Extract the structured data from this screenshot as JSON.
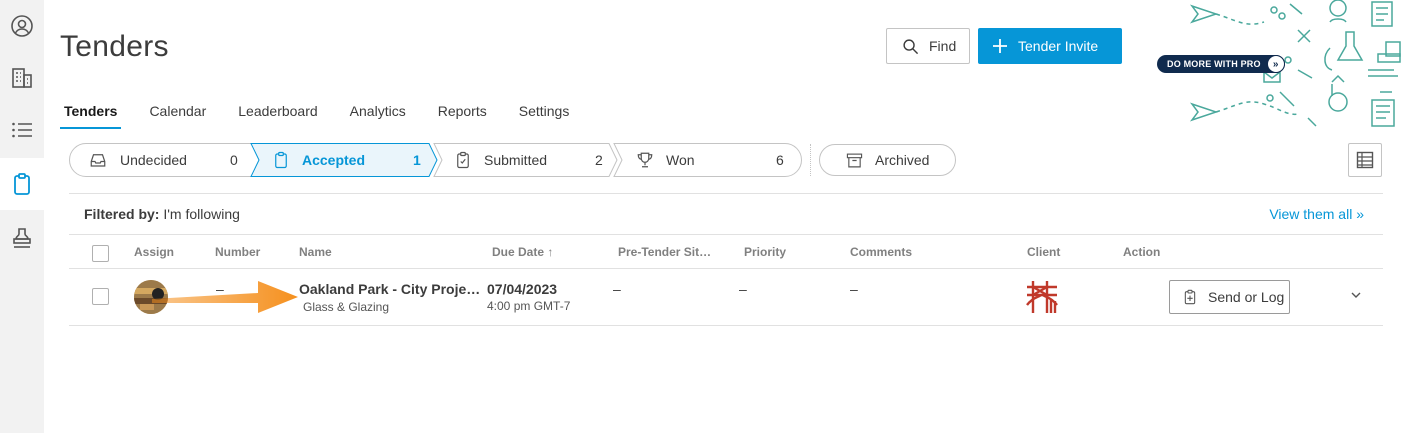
{
  "sidebar": {
    "items": [
      {
        "icon": "user-circle-icon"
      },
      {
        "icon": "building-icon"
      },
      {
        "icon": "list-icon"
      },
      {
        "icon": "clipboard-icon",
        "active": true
      },
      {
        "icon": "stamp-icon"
      }
    ]
  },
  "header": {
    "title": "Tenders",
    "find_label": "Find",
    "invite_label": "Tender Invite",
    "promo_label": "DO MORE WITH PRO"
  },
  "nav": {
    "tabs": [
      {
        "label": "Tenders",
        "active": true
      },
      {
        "label": "Calendar"
      },
      {
        "label": "Leaderboard"
      },
      {
        "label": "Analytics"
      },
      {
        "label": "Reports"
      },
      {
        "label": "Settings"
      }
    ]
  },
  "stages": [
    {
      "label": "Undecided",
      "count": "0",
      "icon": "inbox-tray-icon"
    },
    {
      "label": "Accepted",
      "count": "1",
      "icon": "clipboard-icon",
      "active": true
    },
    {
      "label": "Submitted",
      "count": "2",
      "icon": "clipboard-check-icon"
    },
    {
      "label": "Won",
      "count": "6",
      "icon": "trophy-icon"
    }
  ],
  "archived_label": "Archived",
  "filter": {
    "prefix": "Filtered by:",
    "value": "I'm following",
    "view_all": "View them all »"
  },
  "table": {
    "columns": [
      "Assign",
      "Number",
      "Name",
      "Due Date ↑",
      "Pre-Tender Sit…",
      "Priority",
      "Comments",
      "Client",
      "Action"
    ],
    "rows": [
      {
        "number": "–",
        "name": "Oakland Park - City Proje…",
        "trade": "Glass & Glazing",
        "due_date": "07/04/2023",
        "due_time": "4:00 pm GMT-7",
        "pre_tender": "–",
        "priority": "–",
        "comments": "–",
        "action": "Send or Log"
      }
    ]
  },
  "colors": {
    "accent": "#0696d7",
    "promo_pill": "#102b4e",
    "arrow": "#f5901e",
    "client_logo": "#c0392b"
  }
}
